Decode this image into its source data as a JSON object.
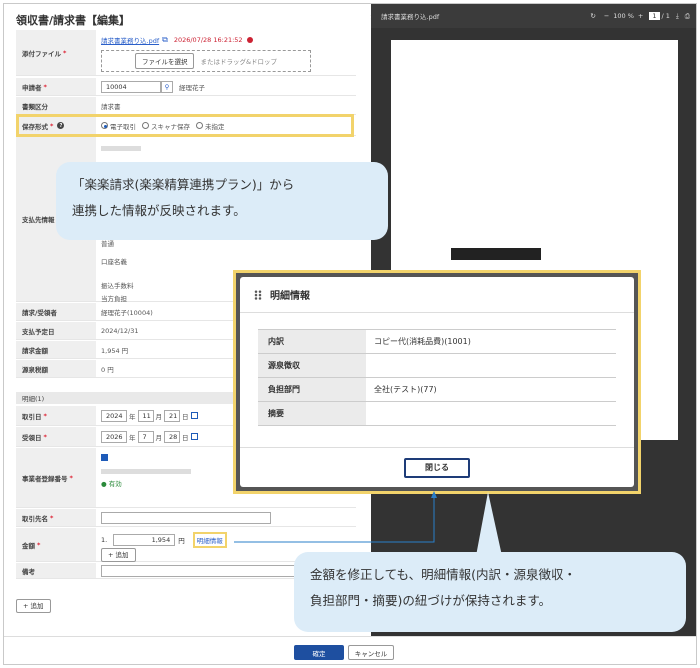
{
  "page": {
    "title": "領収書/請求書【編集】",
    "expand": "»"
  },
  "form": {
    "file_label": "添付ファイル",
    "file_name": "請求書業務り込.pdf",
    "file_date": "2026/07/28 16:21:52",
    "select_file": "ファイルを選択",
    "drop_text": "またはドラッグ&ドロップ",
    "applicant_label": "申請者",
    "applicant_id": "10004",
    "applicant_name": "経理花子",
    "doc_type_label": "書類区分",
    "doc_type": "請求書",
    "storage_label": "保存形式",
    "storage_options": [
      "電子取引",
      "スキャナ保存",
      "未指定"
    ],
    "payee_label": "支払先情報",
    "payee_lines": [
      "普通",
      "口座名義",
      "振込手数料",
      "当方負担"
    ],
    "receiver_label": "請求/受領者",
    "receiver": "経理花子(10004)",
    "due_label": "支払予定日",
    "due_date": "2024/12/31",
    "invoice_amount_label": "請求金額",
    "invoice_amount": "1,954 円",
    "withholding_label": "源泉税額",
    "withholding": "0 円",
    "section_label": "明細(1)",
    "trade_date_label": "取引日",
    "trade_year": "2024",
    "trade_month": "11",
    "trade_day": "21",
    "year_u": "年",
    "month_u": "月",
    "day_u": "日",
    "recv_date_label": "受領日",
    "recv_year": "2026",
    "recv_month": "7",
    "recv_day": "28",
    "reg_label": "事業者登録番号",
    "valid_text": "有効",
    "partner_label": "取引先名",
    "amount_label": "金額",
    "amount_index": "1.",
    "amount_value": "1,954",
    "yen": "円",
    "detail_link": "明細情報",
    "add_row": "+ 追加",
    "memo_label": "備考",
    "add_button": "+ 追加"
  },
  "viewer": {
    "file_name": "請求書業務り込.pdf",
    "zoom": "100 %",
    "page_current": "1",
    "page_total": "/ 1"
  },
  "callouts": {
    "top": [
      "「楽楽請求(楽楽精算連携プラン)」から",
      "連携した情報が反映されます。"
    ],
    "bottom": [
      "金額を修正しても、明細情報(内訳・源泉徴収・",
      "負担部門・摘要)の紐づけが保持されます。"
    ]
  },
  "modal": {
    "title": "明細情報",
    "rows": [
      {
        "k": "内訳",
        "v": "コピー代(消耗品費)(1001)"
      },
      {
        "k": "源泉徴収",
        "v": ""
      },
      {
        "k": "負担部門",
        "v": "全社(テスト)(77)"
      },
      {
        "k": "摘要",
        "v": ""
      }
    ],
    "close": "閉じる"
  },
  "footer": {
    "ok": "確定",
    "cancel": "キャンセル"
  },
  "colors": {
    "highlight": "#f2d36b",
    "callout": "#dcecf8",
    "primary": "#1e4fa0"
  }
}
